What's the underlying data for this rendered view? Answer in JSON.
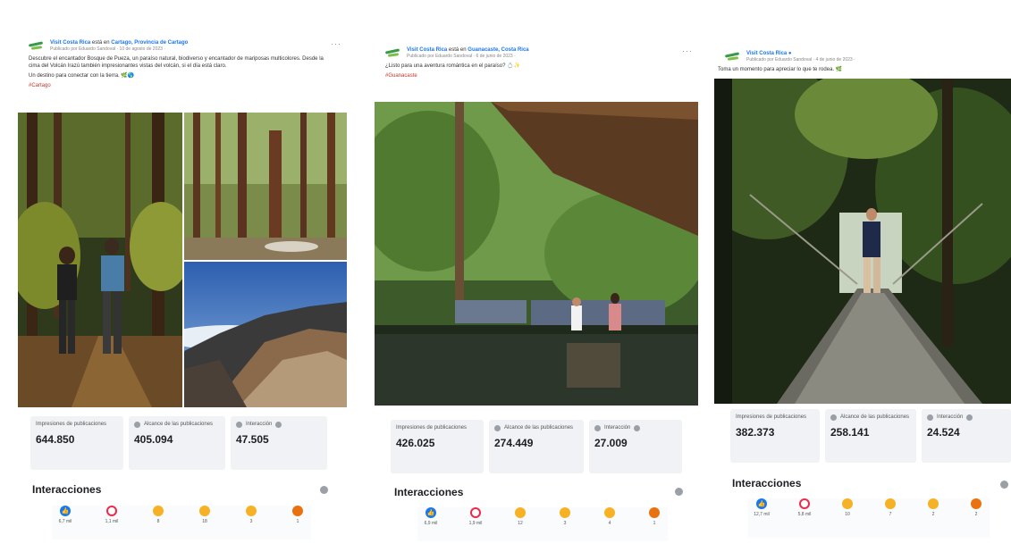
{
  "posts": [
    {
      "page_name": "Visit Costa Rica",
      "location_connector": "está en",
      "location": "Cartago, Provincia de Cartago",
      "meta": "Publicado por Eduardo Sandoval · 10 de agosto de 2023 ·",
      "caption": "Descubre el encantador Bosque de Pueza, un paraíso natural, biodiverso y encantador de mariposas multicolores. Desde la cima del Volcán Irazú también impresionantes vistas del volcán, si el día está claro.",
      "caption2": "Un destino para conectar con la tierra. 🌿🌎",
      "hashtag": "#Cartago",
      "stats": [
        {
          "label": "Impresiones de publicaciones",
          "value": "644.850"
        },
        {
          "label": "Alcance de las publicaciones",
          "value": "405.094"
        },
        {
          "label": "Interacción",
          "value": "47.505"
        }
      ],
      "interactions_title": "Interacciones",
      "reactions": [
        {
          "icon": "like-icon",
          "count": "6,7 mil"
        },
        {
          "icon": "love-icon",
          "count": "1,1 mil"
        },
        {
          "icon": "haha-icon",
          "count": "8"
        },
        {
          "icon": "wow-icon",
          "count": "18"
        },
        {
          "icon": "sad-icon",
          "count": "3"
        },
        {
          "icon": "angry-icon",
          "count": "1"
        }
      ]
    },
    {
      "page_name": "Visit Costa Rica",
      "location_connector": "está en",
      "location": "Guanacaste, Costa Rica",
      "meta": "Publicado por Eduardo Sandoval · 6 de junio de 2023 ·",
      "caption": "¿Listo para una aventura romántica en el paraíso? 💍✨",
      "caption2": "",
      "hashtag": "#Guanacaste",
      "stats": [
        {
          "label": "Impresiones de publicaciones",
          "value": "426.025"
        },
        {
          "label": "Alcance de las publicaciones",
          "value": "274.449"
        },
        {
          "label": "Interacción",
          "value": "27.009"
        }
      ],
      "interactions_title": "Interacciones",
      "reactions": [
        {
          "icon": "like-icon",
          "count": "6,9 mil"
        },
        {
          "icon": "love-icon",
          "count": "1,9 mil"
        },
        {
          "icon": "haha-icon",
          "count": "12"
        },
        {
          "icon": "wow-icon",
          "count": "3"
        },
        {
          "icon": "sad-icon",
          "count": "4"
        },
        {
          "icon": "angry-icon",
          "count": "1"
        }
      ]
    },
    {
      "page_name": "Visit Costa Rica",
      "location_connector": "",
      "location": "",
      "meta": "Publicado por Eduardo Sandoval · 4 de junio de 2023 ·",
      "caption": "Toma un momento para apreciar lo que te rodea. 🌿",
      "caption2": "",
      "hashtag": "",
      "stats": [
        {
          "label": "Impresiones de publicaciones",
          "value": "382.373"
        },
        {
          "label": "Alcance de las publicaciones",
          "value": "258.141"
        },
        {
          "label": "Interacción",
          "value": "24.524"
        }
      ],
      "interactions_title": "Interacciones",
      "reactions": [
        {
          "icon": "like-icon",
          "count": "12,7 mil"
        },
        {
          "icon": "love-icon",
          "count": "5,8 mil"
        },
        {
          "icon": "haha-icon",
          "count": "10"
        },
        {
          "icon": "wow-icon",
          "count": "7"
        },
        {
          "icon": "sad-icon",
          "count": "2"
        },
        {
          "icon": "angry-icon",
          "count": "2"
        }
      ]
    }
  ],
  "colors": {
    "link": "#1877f2",
    "stat_bg": "#f0f2f5",
    "like": "#1877f2",
    "love": "#f02849",
    "emoji": "#f7b125",
    "angry": "#e9710f"
  }
}
